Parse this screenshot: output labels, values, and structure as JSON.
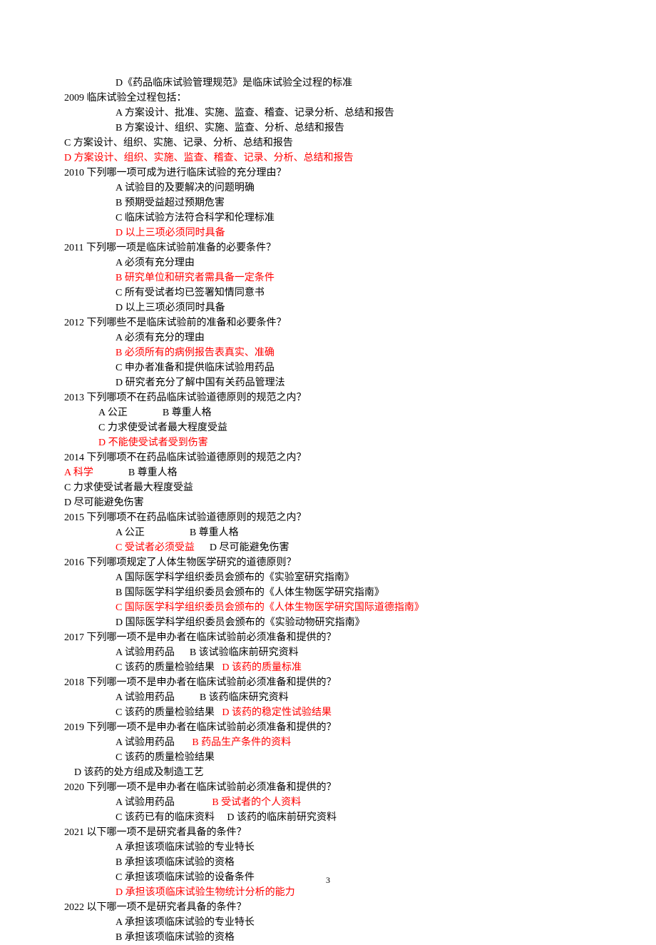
{
  "page_number": "3",
  "lines": [
    {
      "cls": "indent2",
      "spans": [
        {
          "t": "D《药品临床试验管理规范》是临床试验全过程的标准"
        }
      ]
    },
    {
      "cls": "",
      "spans": [
        {
          "t": "2009 临床试验全过程包括："
        }
      ]
    },
    {
      "cls": "indent2",
      "spans": [
        {
          "t": "A 方案设计、批准、实施、监查、稽查、记录分析、总结和报告"
        }
      ]
    },
    {
      "cls": "indent2",
      "spans": [
        {
          "t": "B 方案设计、组织、实施、监查、分析、总结和报告"
        }
      ]
    },
    {
      "cls": "",
      "spans": [
        {
          "t": "C 方案设计、组织、实施、记录、分析、总结和报告"
        }
      ]
    },
    {
      "cls": "",
      "spans": [
        {
          "t": "D 方案设计、组织、实施、监查、稽查、记录、分析、总结和报告",
          "red": true
        }
      ]
    },
    {
      "cls": "",
      "spans": [
        {
          "t": "2010 下列哪一项可成为进行临床试验的充分理由？"
        }
      ]
    },
    {
      "cls": "indent2",
      "spans": [
        {
          "t": "A 试验目的及要解决的问题明确"
        }
      ]
    },
    {
      "cls": "indent2",
      "spans": [
        {
          "t": "B 预期受益超过预期危害"
        }
      ]
    },
    {
      "cls": "indent2",
      "spans": [
        {
          "t": "C 临床试验方法符合科学和伦理标准"
        }
      ]
    },
    {
      "cls": "indent2",
      "spans": [
        {
          "t": "D 以上三项必须同时具备",
          "red": true
        }
      ]
    },
    {
      "cls": "",
      "spans": [
        {
          "t": "2011 下列哪一项是临床试验前准备的必要条件？"
        }
      ]
    },
    {
      "cls": "indent2",
      "spans": [
        {
          "t": "A 必须有充分理由"
        }
      ]
    },
    {
      "cls": "indent2",
      "spans": [
        {
          "t": "B 研究单位和研究者需具备一定条件",
          "red": true
        }
      ]
    },
    {
      "cls": "indent2",
      "spans": [
        {
          "t": "C 所有受试者均已签署知情同意书"
        }
      ]
    },
    {
      "cls": "indent2",
      "spans": [
        {
          "t": "D 以上三项必须同时具备"
        }
      ]
    },
    {
      "cls": "",
      "spans": [
        {
          "t": "2012 下列哪些不是临床试验前的准备和必要条件？"
        }
      ]
    },
    {
      "cls": "indent2",
      "spans": [
        {
          "t": "A 必须有充分的理由"
        }
      ]
    },
    {
      "cls": "indent2",
      "spans": [
        {
          "t": "B 必须所有的病例报告表真实、准确",
          "red": true
        }
      ]
    },
    {
      "cls": "indent2",
      "spans": [
        {
          "t": "C 申办者准备和提供临床试验用药品"
        }
      ]
    },
    {
      "cls": "indent2",
      "spans": [
        {
          "t": "D 研究者充分了解中国有关药品管理法"
        }
      ]
    },
    {
      "cls": "",
      "spans": [
        {
          "t": "2013 下列哪项不在药品临床试验道德原则的规范之内？"
        }
      ]
    },
    {
      "cls": "indent15",
      "spans": [
        {
          "t": "A 公正              B 尊重人格"
        }
      ]
    },
    {
      "cls": "indent15",
      "spans": [
        {
          "t": "C 力求使受试者最大程度受益"
        }
      ]
    },
    {
      "cls": "indent15",
      "spans": [
        {
          "t": "D 不能使受试者受到伤害",
          "red": true
        }
      ]
    },
    {
      "cls": "",
      "spans": [
        {
          "t": "2014 下列哪项不在药品临床试验道德原则的规范之内？"
        }
      ]
    },
    {
      "cls": "",
      "spans": [
        {
          "t": "A 科学",
          "red": true
        },
        {
          "t": "              B 尊重人格"
        }
      ]
    },
    {
      "cls": "",
      "spans": [
        {
          "t": "C 力求使受试者最大程度受益"
        }
      ]
    },
    {
      "cls": "",
      "spans": [
        {
          "t": "D 尽可能避免伤害"
        }
      ]
    },
    {
      "cls": "",
      "spans": [
        {
          "t": "2015 下列哪项不在药品临床试验道德原则的规范之内？"
        }
      ]
    },
    {
      "cls": "indent2",
      "spans": [
        {
          "t": "A 公正                  B 尊重人格"
        }
      ]
    },
    {
      "cls": "indent2",
      "spans": [
        {
          "t": "C 受试者必须受益",
          "red": true
        },
        {
          "t": "      D 尽可能避免伤害"
        }
      ]
    },
    {
      "cls": "",
      "spans": [
        {
          "t": "2016 下列哪项规定了人体生物医学研究的道德原则？"
        }
      ]
    },
    {
      "cls": "indent2",
      "spans": [
        {
          "t": "A 国际医学科学组织委员会颁布的《实验室研究指南》"
        }
      ]
    },
    {
      "cls": "indent2",
      "spans": [
        {
          "t": "B 国际医学科学组织委员会颁布的《人体生物医学研究指南》"
        }
      ]
    },
    {
      "cls": "indent2",
      "spans": [
        {
          "t": "C 国际医学科学组织委员会颁布的《人体生物医学研究国际道德指南》",
          "red": true
        }
      ]
    },
    {
      "cls": "indent2",
      "spans": [
        {
          "t": "D 国际医学科学组织委员会颁布的《实验动物研究指南》"
        }
      ]
    },
    {
      "cls": "",
      "spans": [
        {
          "t": "2017 下列哪一项不是申办者在临床试验前必须准备和提供的？"
        }
      ]
    },
    {
      "cls": "indent2",
      "spans": [
        {
          "t": "A 试验用药品      B 该试验临床前研究资料"
        }
      ]
    },
    {
      "cls": "indent2",
      "spans": [
        {
          "t": "C 该药的质量检验结果   "
        },
        {
          "t": "D 该药的质量标准",
          "red": true
        }
      ]
    },
    {
      "cls": "",
      "spans": [
        {
          "t": "2018 下列哪一项不是申办者在临床试验前必须准备和提供的？"
        }
      ]
    },
    {
      "cls": "indent2",
      "spans": [
        {
          "t": "A 试验用药品          B 该药临床研究资料"
        }
      ]
    },
    {
      "cls": "indent2",
      "spans": [
        {
          "t": "C 该药的质量检验结果   "
        },
        {
          "t": "D 该药的稳定性试验结果",
          "red": true
        }
      ]
    },
    {
      "cls": "",
      "spans": [
        {
          "t": "2019 下列哪一项不是申办者在临床试验前必须准备和提供的？"
        }
      ]
    },
    {
      "cls": "indent2",
      "spans": [
        {
          "t": "A 试验用药品       "
        },
        {
          "t": "B 药品生产条件的资料",
          "red": true
        }
      ]
    },
    {
      "cls": "indent2",
      "spans": [
        {
          "t": "C 该药的质量检验结果"
        }
      ]
    },
    {
      "cls": "indent14",
      "spans": [
        {
          "t": "D 该药的处方组成及制造工艺"
        }
      ]
    },
    {
      "cls": "",
      "spans": [
        {
          "t": "2020 下列哪一项不是申办者在临床试验前必须准备和提供的？"
        }
      ]
    },
    {
      "cls": "indent2",
      "spans": [
        {
          "t": "A 试验用药品               "
        },
        {
          "t": "B 受试者的个人资料",
          "red": true
        }
      ]
    },
    {
      "cls": "indent2",
      "spans": [
        {
          "t": "C 该药已有的临床资料     D 该药的临床前研究资料"
        }
      ]
    },
    {
      "cls": "",
      "spans": [
        {
          "t": "2021 以下哪一项不是研究者具备的条件？"
        }
      ]
    },
    {
      "cls": "indent2",
      "spans": [
        {
          "t": "A 承担该项临床试验的专业特长"
        }
      ]
    },
    {
      "cls": "indent2",
      "spans": [
        {
          "t": "B 承担该项临床试验的资格"
        }
      ]
    },
    {
      "cls": "indent2",
      "spans": [
        {
          "t": "C 承担该项临床试验的设备条件"
        }
      ]
    },
    {
      "cls": "indent2",
      "spans": [
        {
          "t": "D 承担该项临床试验生物统计分析的能力",
          "red": true
        }
      ]
    },
    {
      "cls": "",
      "spans": [
        {
          "t": "2022 以下哪一项不是研究者具备的条件？"
        }
      ]
    },
    {
      "cls": "indent2",
      "spans": [
        {
          "t": "A 承担该项临床试验的专业特长"
        }
      ]
    },
    {
      "cls": "indent2",
      "spans": [
        {
          "t": "B 承担该项临床试验的资格"
        }
      ]
    }
  ]
}
